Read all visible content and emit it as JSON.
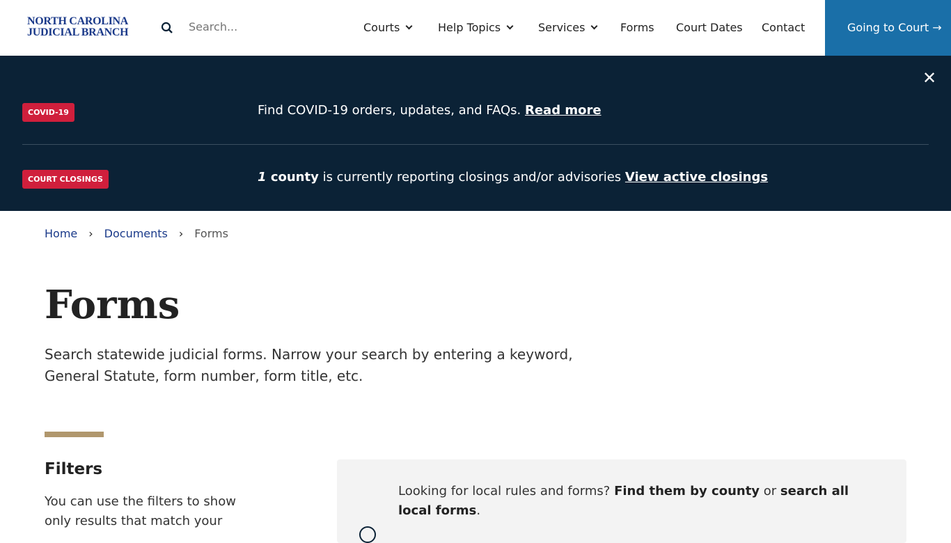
{
  "header": {
    "logo_line1": "NORTH CAROLINA",
    "logo_line2": "JUDICIAL BRANCH",
    "search_placeholder": "Search...",
    "nav": [
      "Courts",
      "Help Topics",
      "Services",
      "Forms",
      "Court Dates",
      "Contact"
    ],
    "cta": "Going to Court →"
  },
  "alerts": {
    "covid_badge": "COVID-19",
    "covid_text": "Find COVID-19 orders, updates, and FAQs.",
    "covid_link": "Read more",
    "closings_badge": "COURT CLOSINGS",
    "closings_count": "1",
    "closings_bold": "county",
    "closings_text": "is currently reporting closings and/or advisories",
    "closings_link": "View active closings",
    "close": "✕"
  },
  "breadcrumb": [
    "Home",
    "Documents",
    "Forms"
  ],
  "page": {
    "title": "Forms",
    "intro": "Search statewide judicial forms. Narrow your search by entering a keyword, General Statute, form number, form title, etc."
  },
  "filters": {
    "title": "Filters",
    "text": "You can use the filters to show only results that match your"
  },
  "local": {
    "text": "Looking for local rules and forms?",
    "link1": "Find them by county",
    "or": "or",
    "link2": "search all local forms",
    "end": "."
  }
}
